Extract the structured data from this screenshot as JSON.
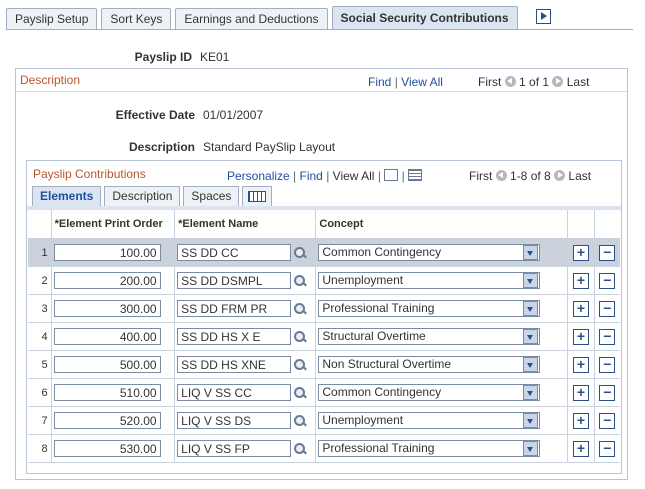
{
  "tabs": [
    "Payslip Setup",
    "Sort Keys",
    "Earnings and Deductions",
    "Social Security Contributions"
  ],
  "payslip_id": {
    "label": "Payslip ID",
    "value": "KE01"
  },
  "description_box": {
    "title": "Description",
    "find": "Find",
    "view_all": "View All",
    "first": "First",
    "range": "1 of 1",
    "last": "Last",
    "effective_date_label": "Effective Date",
    "effective_date": "01/01/2007",
    "description_label": "Description",
    "description": "Standard PaySlip Layout"
  },
  "grid": {
    "title": "Payslip Contributions",
    "personalize": "Personalize",
    "find": "Find",
    "view_all": "View All",
    "first": "First",
    "range": "1-8 of 8",
    "last": "Last",
    "tabs": [
      "Elements",
      "Description",
      "Spaces"
    ],
    "headers": [
      "*Element Print Order",
      "*Element Name",
      "Concept"
    ],
    "rows": [
      {
        "n": "1",
        "order": "100.00",
        "name": "SS DD CC",
        "concept": "Common Contingency"
      },
      {
        "n": "2",
        "order": "200.00",
        "name": "SS DD DSMPL",
        "concept": "Unemployment"
      },
      {
        "n": "3",
        "order": "300.00",
        "name": "SS DD FRM PR",
        "concept": "Professional Training"
      },
      {
        "n": "4",
        "order": "400.00",
        "name": "SS DD HS X E",
        "concept": "Structural Overtime"
      },
      {
        "n": "5",
        "order": "500.00",
        "name": "SS DD HS XNE",
        "concept": "Non Structural Overtime"
      },
      {
        "n": "6",
        "order": "510.00",
        "name": "LIQ V SS CC",
        "concept": "Common Contingency"
      },
      {
        "n": "7",
        "order": "520.00",
        "name": "LIQ V SS DS",
        "concept": "Unemployment"
      },
      {
        "n": "8",
        "order": "530.00",
        "name": "LIQ V SS FP",
        "concept": "Professional Training"
      }
    ]
  },
  "glyphs": {
    "plus": "+",
    "minus": "−",
    "sep": "|"
  }
}
